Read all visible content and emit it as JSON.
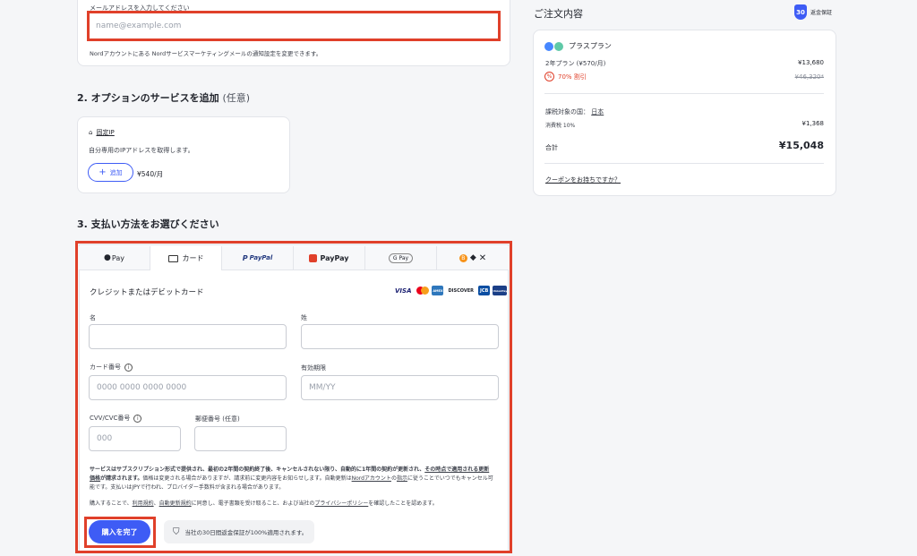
{
  "email": {
    "label": "メールアドレスを入力してください",
    "placeholder": "name@example.com",
    "note": "Nordアカウントにある Nordサービスマーケティングメールの通知設定を変更できます。"
  },
  "options": {
    "heading": "2. オプションのサービスを追加",
    "heading_note": "(任意)",
    "item_name": "固定IP",
    "item_desc": "自分専用のIPアドレスを取得します。",
    "add_label": "追加",
    "price": "¥540/月"
  },
  "payment": {
    "heading": "3. 支払い方法をお選びください",
    "tabs": [
      {
        "label": "Pay"
      },
      {
        "label": "カード"
      },
      {
        "label": "PayPal"
      },
      {
        "label": "PayPay"
      },
      {
        "label": "G Pay"
      },
      {
        "label": ""
      }
    ],
    "card_title": "クレジットまたはデビットカード",
    "card_brands": [
      "VISA",
      "MC",
      "AMEX",
      "DISCOVER",
      "JCB",
      "UnionPay"
    ],
    "first_name_label": "名",
    "last_name_label": "姓",
    "card_number_label": "カード番号",
    "card_number_placeholder": "0000 0000 0000 0000",
    "expiry_label": "有効期限",
    "expiry_placeholder": "MM/YY",
    "cvv_label": "CVV/CVC番号",
    "cvv_placeholder": "000",
    "postal_label": "郵便番号 (任意)",
    "terms_bold": "サービスはサブスクリプション形式で提供され、最初の2年間の契約終了後、キャンセルされない限り、自動的に1年間の契約が更新され、",
    "terms_bold_link": "その時点で適用される更新価格",
    "terms_bold_tail": "が請求されます。",
    "terms_normal": "価格は変更される場合がありますが、請求前に変更内容をお知らせします。自動更新は",
    "terms_link1": "Nordアカウント",
    "terms_mid": "の",
    "terms_link2": "指示",
    "terms_tail": "に従うことでいつでもキャンセル可能です。支払いはJPYで行われ、プロバイダー手数料が含まれる場合があります。",
    "consent_a": "購入することで、",
    "consent_link1": "利用規約",
    "consent_b": "、",
    "consent_link2": "自動更新規約",
    "consent_c": "に同意し、電子書類を受け取ること、および当社の",
    "consent_link3": "プライバシーポリシー",
    "consent_d": "を確認したことを認めます。",
    "buy_label": "購入を完了",
    "guarantee": "当社の30日間返金保証が100%適用されます。"
  },
  "summary": {
    "heading": "ご注文内容",
    "badge_number": "30",
    "badge_text": "返金保証",
    "plan_name": "プラスプラン",
    "plan_period": "2年プラン (¥570/月)",
    "plan_price": "¥13,680",
    "discount": "70% 割引",
    "original_price": "¥46,320*",
    "tax_country_label": "課税対象の国：",
    "tax_country": "日本",
    "tax_label": "消費税 10%",
    "tax_value": "¥1,368",
    "total_label": "合計",
    "total_value": "¥15,048",
    "coupon": "クーポンをお持ちですか？"
  },
  "colors": {
    "accent": "#3e5cf5",
    "highlight": "#e0402a",
    "discount": "#e0402a"
  }
}
